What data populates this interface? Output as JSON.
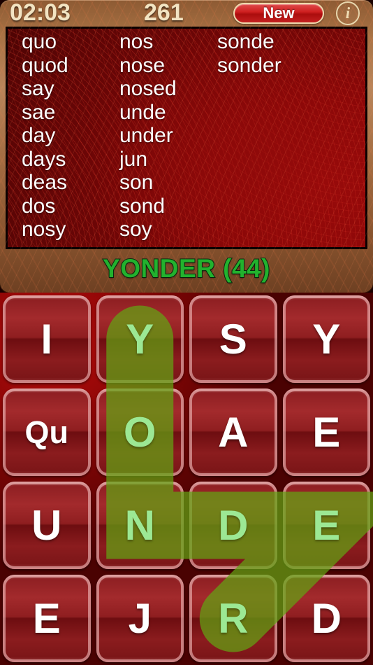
{
  "header": {
    "timer": "02:03",
    "score": "261",
    "new_label": "New",
    "info_label": "i"
  },
  "word_list": {
    "columns": [
      [
        "quo",
        "quod",
        "say",
        "sae",
        "day",
        "days",
        "deas",
        "dos",
        "nosy"
      ],
      [
        "nos",
        "nose",
        "nosed",
        "unde",
        "under",
        "jun",
        "son",
        "sond",
        "soy"
      ],
      [
        "sonde",
        "sonder"
      ]
    ]
  },
  "status": {
    "text": "YONDER (44)",
    "word": "YONDER",
    "points": 44,
    "color": "#22b22e"
  },
  "grid": {
    "rows": 4,
    "cols": 4,
    "letters": [
      [
        "I",
        "Y",
        "S",
        "Y"
      ],
      [
        "Qu",
        "O",
        "A",
        "E"
      ],
      [
        "U",
        "N",
        "D",
        "E"
      ],
      [
        "E",
        "J",
        "R",
        "D"
      ]
    ],
    "selected_path": [
      {
        "row": 0,
        "col": 1,
        "letter": "Y"
      },
      {
        "row": 1,
        "col": 1,
        "letter": "O"
      },
      {
        "row": 2,
        "col": 1,
        "letter": "N"
      },
      {
        "row": 2,
        "col": 2,
        "letter": "D"
      },
      {
        "row": 2,
        "col": 3,
        "letter": "E"
      },
      {
        "row": 3,
        "col": 2,
        "letter": "R"
      }
    ],
    "path_color": "#63a314",
    "tile_color": "#8f1e20"
  },
  "theme": {
    "panel_bronze": "#a87244",
    "word_panel_red": "#8d0808",
    "accent_red": "#cf2020",
    "text_cream": "#f2e4c2"
  }
}
